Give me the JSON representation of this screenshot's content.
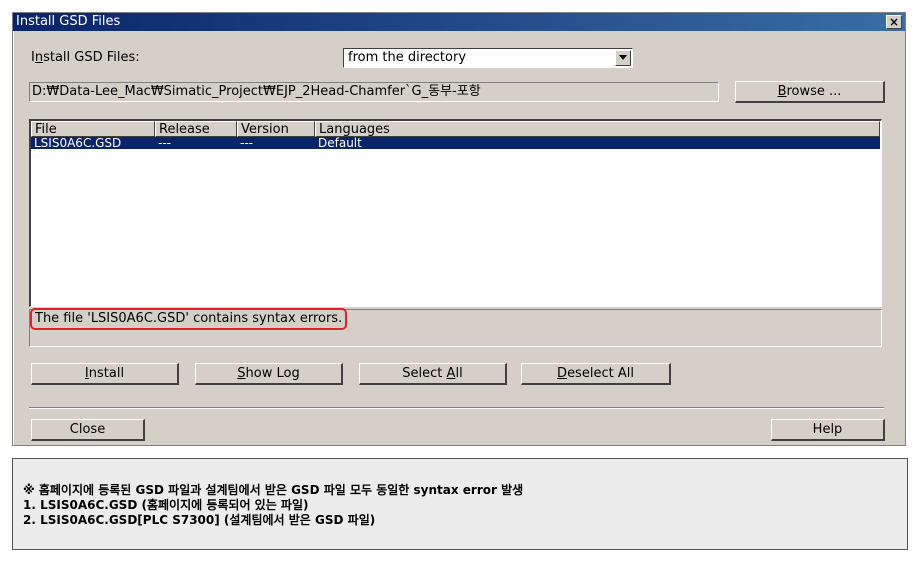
{
  "dialog": {
    "title": "Install GSD Files",
    "close_glyph": "×",
    "install_label_pre": "I",
    "install_label_u": "n",
    "install_label_post": "stall GSD Files:",
    "source_select": {
      "value": "from the directory"
    },
    "path": "D:₩Data-Lee_Mac₩Simatic_Project₩EJP_2Head-Chamfer`G_동부-포항",
    "browse_u": "B",
    "browse_rest": "rowse ...",
    "list": {
      "headers": [
        "File",
        "Release",
        "Version",
        "Languages"
      ],
      "rows": [
        {
          "file": "LSIS0A6C.GSD",
          "release": "---",
          "version": "---",
          "languages": "Default"
        }
      ]
    },
    "status_message": "The file 'LSIS0A6C.GSD' contains syntax errors.",
    "buttons": {
      "install_u": "I",
      "install_rest": "nstall",
      "show_log_u": "S",
      "show_log_rest": "how Log",
      "select_all_pre": "Select ",
      "select_all_u": "A",
      "select_all_rest": "ll",
      "deselect_all_u": "D",
      "deselect_all_rest": "eselect All",
      "close": "Close",
      "help": "Help"
    }
  },
  "note": {
    "line1": "※ 홈페이지에 등록된 GSD 파일과 설계팀에서 받은 GSD 파일 모두 동일한 syntax error 발생",
    "line2": "1.  LSIS0A6C.GSD (홈페이지에 등록되어 있는 파일)",
    "line3": "2.  LSIS0A6C.GSD[PLC S7300] (설계팀에서 받은 GSD 파일)"
  },
  "colors": {
    "titlebar": "#0a246a",
    "dialog_bg": "#d4d0c8",
    "selection": "#0a246a",
    "highlight_box": "#e0202a"
  }
}
